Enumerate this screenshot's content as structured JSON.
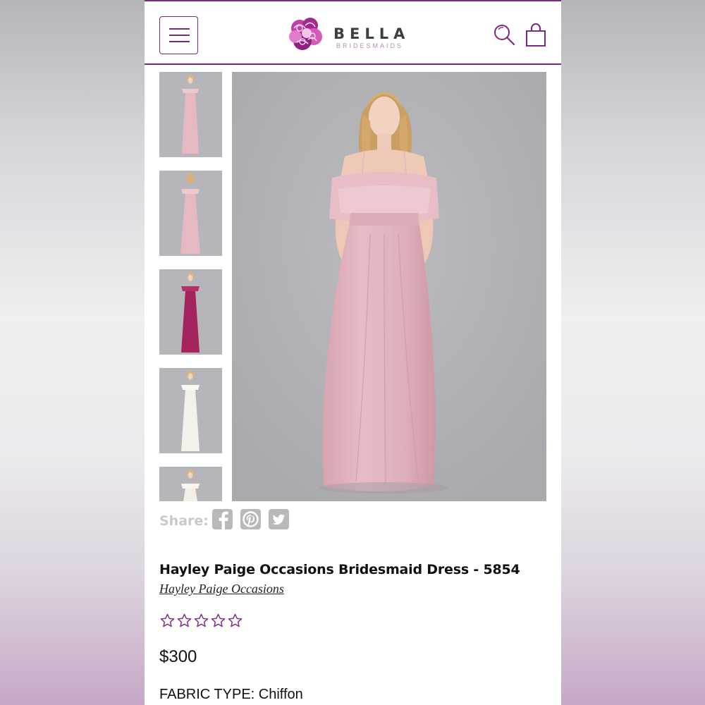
{
  "header": {
    "brand_name": "BELLA",
    "brand_sub": "BRIDESMAIDS",
    "accent_color": "#7b2a7d",
    "menu_icon": "hamburger-icon",
    "search_icon": "search-icon",
    "bag_icon": "shopping-bag-icon"
  },
  "gallery": {
    "thumbnails": [
      {
        "dress_color": "#e6b9c2"
      },
      {
        "dress_color": "#e6b9c2"
      },
      {
        "dress_color": "#a3245c"
      },
      {
        "dress_color": "#f4f1ea"
      },
      {
        "dress_color": "#f4efe6"
      }
    ],
    "main_dress_color": "#e4b6c0",
    "selected_index": 0
  },
  "share": {
    "label": "Share:",
    "icons": [
      "facebook-icon",
      "pinterest-icon",
      "twitter-icon"
    ]
  },
  "product": {
    "title": "Hayley Paige Occasions Bridesmaid Dress - 5854",
    "brand": "Hayley Paige Occasions",
    "rating": 0,
    "rating_max": 5,
    "price": "$300",
    "fabric": "FABRIC TYPE: Chiffon"
  }
}
